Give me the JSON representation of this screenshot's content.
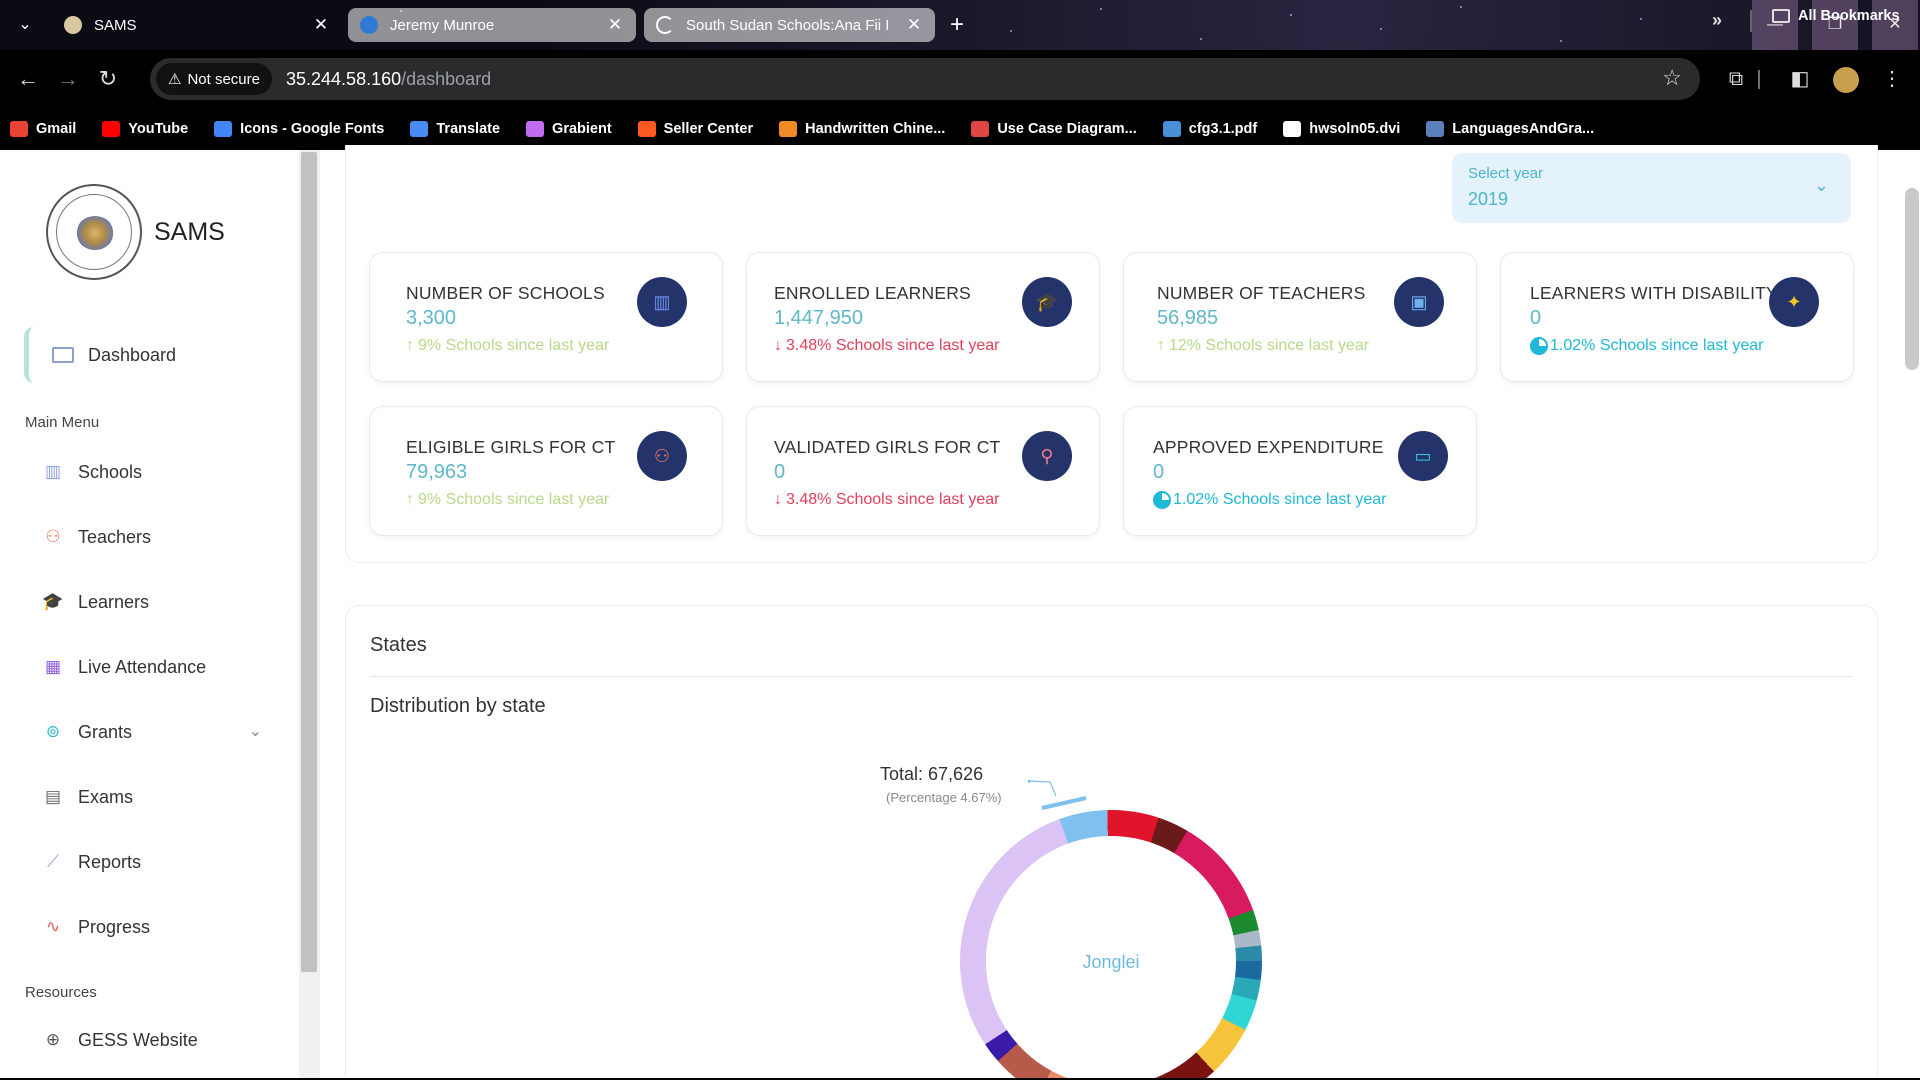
{
  "browser": {
    "tabs": [
      {
        "label": "SAMS",
        "active": true
      },
      {
        "label": "Jeremy Munroe",
        "active": false
      },
      {
        "label": "South Sudan Schools:Ana Fii I",
        "active": false
      }
    ],
    "not_secure_label": "Not secure",
    "url_host": "35.244.58.160",
    "url_path": "/dashboard",
    "bookmarks": [
      {
        "label": "Gmail",
        "icon": "gmail-icon",
        "color": "#ea4335"
      },
      {
        "label": "YouTube",
        "icon": "youtube-icon",
        "color": "#ff0000"
      },
      {
        "label": "Icons - Google Fonts",
        "icon": "google-fonts-icon",
        "color": "#4285f4"
      },
      {
        "label": "Translate",
        "icon": "translate-icon",
        "color": "#4a8af4"
      },
      {
        "label": "Grabient",
        "icon": "grabient-icon",
        "color": "#c06cf0"
      },
      {
        "label": "Seller Center",
        "icon": "seller-center-icon",
        "color": "#ff5a1f"
      },
      {
        "label": "Handwritten Chine...",
        "icon": "handwritten-icon",
        "color": "#f08a24"
      },
      {
        "label": "Use Case Diagram...",
        "icon": "diagram-icon",
        "color": "#e24444"
      },
      {
        "label": "cfg3.1.pdf",
        "icon": "pdf-icon",
        "color": "#4a90d9"
      },
      {
        "label": "hwsoln05.dvi",
        "icon": "dvi-icon",
        "color": "#ffffff"
      },
      {
        "label": "LanguagesAndGra...",
        "icon": "doc-icon",
        "color": "#5b7fb8"
      }
    ],
    "all_bookmarks_label": "All Bookmarks"
  },
  "sidebar": {
    "brand": "SAMS",
    "dashboard_label": "Dashboard",
    "main_menu_label": "Main Menu",
    "items": [
      {
        "label": "Schools",
        "icon": "bar-chart-icon",
        "color": "#8a9de0"
      },
      {
        "label": "Teachers",
        "icon": "users-icon",
        "color": "#f07a5a"
      },
      {
        "label": "Learners",
        "icon": "graduation-cap-icon",
        "color": "#b5d56a"
      },
      {
        "label": "Live Attendance",
        "icon": "calendar-icon",
        "color": "#8a5ae0"
      },
      {
        "label": "Grants",
        "icon": "money-icon",
        "color": "#35b8c8"
      },
      {
        "label": "Exams",
        "icon": "document-icon",
        "color": "#666666"
      },
      {
        "label": "Reports",
        "icon": "line-chart-icon",
        "color": "#b08ad8"
      },
      {
        "label": "Progress",
        "icon": "activity-icon",
        "color": "#e05a5a"
      }
    ],
    "resources_label": "Resources",
    "resources": [
      {
        "label": "GESS Website",
        "icon": "globe-icon",
        "color": "#555555"
      }
    ]
  },
  "year_select": {
    "label": "Select year",
    "value": "2019"
  },
  "stats": [
    {
      "title": "NUMBER OF SCHOOLS",
      "value": "3,300",
      "trend": "up",
      "arrow": "↑",
      "change": "9% Schools since last year",
      "icon": "bar-chart-icon"
    },
    {
      "title": "ENROLLED LEARNERS",
      "value": "1,447,950",
      "trend": "down",
      "arrow": "↓",
      "change": "3.48% Schools since last year",
      "icon": "graduation-cap-icon"
    },
    {
      "title": "NUMBER OF TEACHERS",
      "value": "56,985",
      "trend": "up",
      "arrow": "↑",
      "change": "12% Schools since last year",
      "icon": "id-card-icon"
    },
    {
      "title": "LEARNERS WITH DISABILITY",
      "value": "0",
      "trend": "info",
      "arrow": "",
      "change": "1.02% Schools since last year",
      "icon": "accessibility-icon"
    },
    {
      "title": "ELIGIBLE GIRLS FOR CT",
      "value": "79,963",
      "trend": "up",
      "arrow": "↑",
      "change": "9% Schools since last year",
      "icon": "users-icon"
    },
    {
      "title": "VALIDATED GIRLS FOR CT",
      "value": "0",
      "trend": "down",
      "arrow": "↓",
      "change": "3.48% Schools since last year",
      "icon": "user-plus-icon"
    },
    {
      "title": "APPROVED EXPENDITURE",
      "value": "0",
      "trend": "info",
      "arrow": "",
      "change": "1.02% Schools since last year",
      "icon": "money-icon"
    }
  ],
  "states": {
    "title": "States",
    "subtitle": "Distribution by state",
    "center_label": "Jonglei",
    "tooltip_total": "Total: 67,626",
    "tooltip_percentage": "(Percentage 4.67%)"
  },
  "chart_data": {
    "type": "pie",
    "style": "donut",
    "title": "Distribution by state",
    "center_label": "Jonglei",
    "highlighted": {
      "total": 67626,
      "percentage": 4.67
    },
    "segments": [
      {
        "color": "#7ec0ee",
        "percent": 4.67
      },
      {
        "color": "#e0142a",
        "percent": 5.0
      },
      {
        "color": "#6b1a1a",
        "percent": 3.0
      },
      {
        "color": "#d81b60",
        "percent": 10.0
      },
      {
        "color": "#1b8a2e",
        "percent": 2.0
      },
      {
        "color": "#aab8c8",
        "percent": 1.5
      },
      {
        "color": "#2a8aa8",
        "percent": 1.5
      },
      {
        "color": "#1a6aa0",
        "percent": 1.8
      },
      {
        "color": "#2aa8b8",
        "percent": 2.0
      },
      {
        "color": "#30d5d5",
        "percent": 3.0
      },
      {
        "color": "#f7c33a",
        "percent": 5.0
      },
      {
        "color": "#7a1212",
        "percent": 7.0
      },
      {
        "color": "#2a7ab8",
        "percent": 5.0
      },
      {
        "color": "#9bd14a",
        "percent": 3.0
      },
      {
        "color": "#ef8a6a",
        "percent": 3.0
      },
      {
        "color": "#b85a4a",
        "percent": 5.0
      },
      {
        "color": "#3a1aa8",
        "percent": 2.0
      },
      {
        "color": "#dcc3f5",
        "percent": 26.03
      }
    ]
  }
}
